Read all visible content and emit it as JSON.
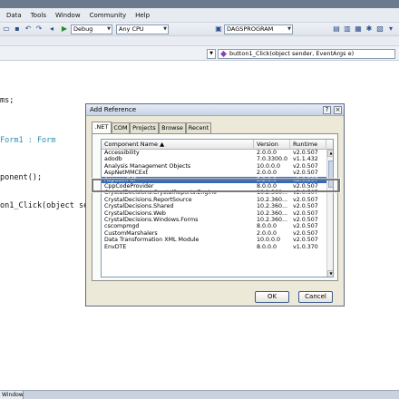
{
  "menubar": {
    "items": [
      "Data",
      "Tools",
      "Window",
      "Community",
      "Help"
    ]
  },
  "toolbar": {
    "config": "Debug",
    "platform": "Any CPU",
    "project": "DAGSPROGRAM"
  },
  "navbar": {
    "member_value": "button1_Click(object sender, EventArgs e)"
  },
  "editor": {
    "lines": [
      "ms;",
      "Form1 : Form",
      "ponent();",
      "on1_Click(object se"
    ]
  },
  "taskbar": {
    "window_tab": "Window"
  },
  "dialog": {
    "title": "Add Reference",
    "tabs": [
      ".NET",
      "COM",
      "Projects",
      "Browse",
      "Recent"
    ],
    "columns": [
      "Component Name",
      "Version",
      "Runtime"
    ],
    "rows": [
      {
        "name": "Accessibility",
        "version": "2.0.0.0",
        "runtime": "v2.0.507"
      },
      {
        "name": "adodb",
        "version": "7.0.3300.0",
        "runtime": "v1.1.432"
      },
      {
        "name": "Analysis Management Objects",
        "version": "10.0.0.0",
        "runtime": "v2.0.507"
      },
      {
        "name": "AspNetMMCExt",
        "version": "2.0.0.0",
        "runtime": "v2.0.507"
      },
      {
        "name": "Aspose.Pdf",
        "version": "5.2.0.0",
        "runtime": "v2.0.507"
      },
      {
        "name": "CppCodeProvider",
        "version": "8.0.0.0",
        "runtime": "v2.0.507"
      },
      {
        "name": "CrystalDecisions.CrystalReports.Engine",
        "version": "10.2.360...",
        "runtime": "v2.0.507"
      },
      {
        "name": "CrystalDecisions.ReportSource",
        "version": "10.2.360...",
        "runtime": "v2.0.507"
      },
      {
        "name": "CrystalDecisions.Shared",
        "version": "10.2.360...",
        "runtime": "v2.0.507"
      },
      {
        "name": "CrystalDecisions.Web",
        "version": "10.2.360...",
        "runtime": "v2.0.507"
      },
      {
        "name": "CrystalDecisions.Windows.Forms",
        "version": "10.2.360...",
        "runtime": "v2.0.507"
      },
      {
        "name": "cscompmgd",
        "version": "8.0.0.0",
        "runtime": "v2.0.507"
      },
      {
        "name": "CustomMarshalers",
        "version": "2.0.0.0",
        "runtime": "v2.0.507"
      },
      {
        "name": "Data Transformation XML Module",
        "version": "10.0.0.0",
        "runtime": "v2.0.507"
      },
      {
        "name": "EnvDTE",
        "version": "8.0.0.0",
        "runtime": "v1.0.370"
      }
    ],
    "selected_index": 4,
    "ok_label": "OK",
    "cancel_label": "Cancel"
  },
  "colors": {
    "selection": "#316ac5",
    "dialog_bg": "#ece9d8",
    "type_name": "#2b91af"
  }
}
